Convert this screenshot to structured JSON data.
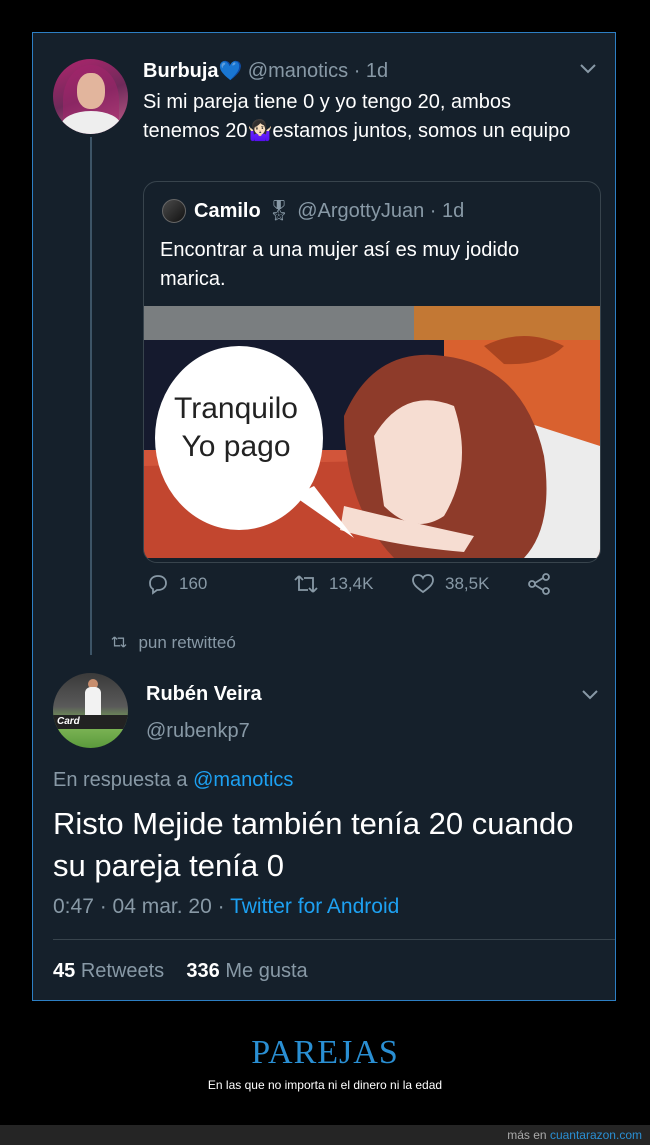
{
  "tweet1": {
    "name": "Burbuja",
    "handle": "@manotics",
    "time": "· 1d",
    "text": "Si mi pareja tiene 0 y yo tengo 20, ambos tenemos 20🤷🏻‍♀️estamos juntos, somos un equipo",
    "quote": {
      "name": "Camilo",
      "name_emoji": "🎖",
      "handle": "@ArgottyJuan",
      "time": "· 1d",
      "text": "Encontrar a una mujer así es muy jodido marica.",
      "image_text": [
        "Tranquilo",
        "Yo pago"
      ]
    },
    "replies": "160",
    "retweets": "13,4K",
    "likes": "38,5K"
  },
  "retweet_label": "pun retwitteó",
  "tweet2": {
    "name": "Rubén Veira",
    "handle": "@rubenkp7",
    "reply_to_prefix": "En respuesta a",
    "reply_to_handle": "@manotics",
    "avatar_text": "Card",
    "text": "Risto Mejide también tenía 20 cuando su pareja tenía 0",
    "time": "0:47 · 04 mar. 20 ·",
    "source": "Twitter for Android",
    "retweets_count": "45",
    "retweets_label": "Retweets",
    "likes_count": "336",
    "likes_label": "Me gusta"
  },
  "page": {
    "title": "PAREJAS",
    "subtitle": "En las que no importa ni el dinero ni la edad",
    "footer_prefix": "más en",
    "footer_site": "cuantarazon.com"
  }
}
